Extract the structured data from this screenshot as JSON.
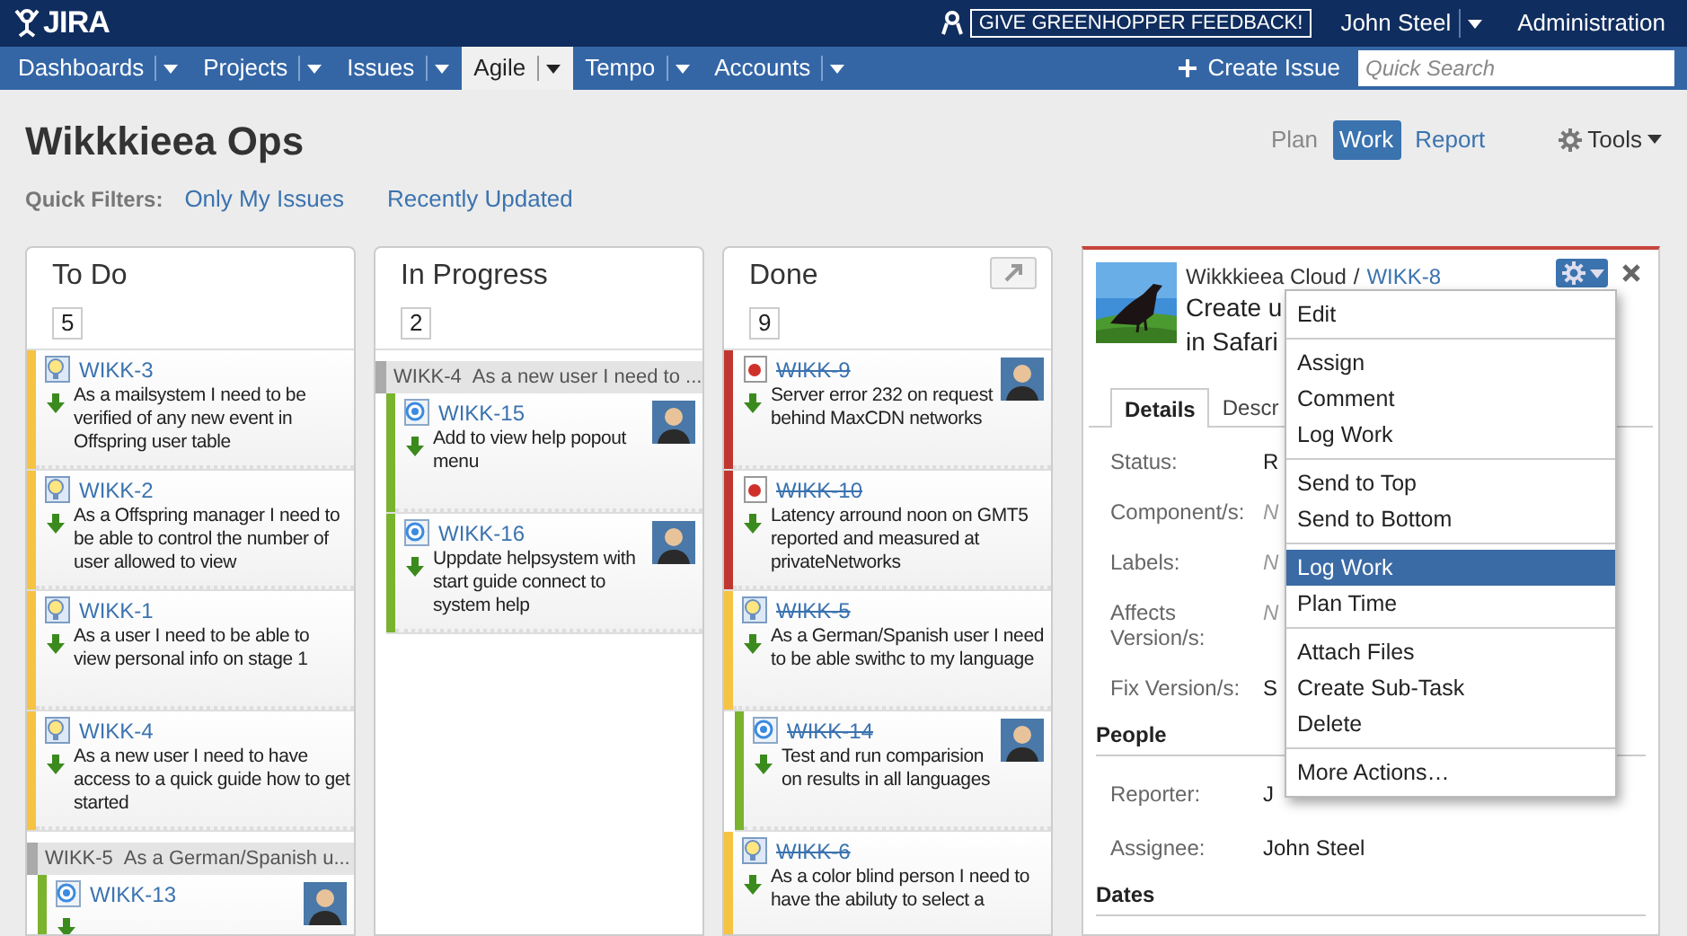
{
  "header": {
    "logo": "JIRA",
    "feedback": "GIVE GREENHOPPER FEEDBACK!",
    "user": "John Steel",
    "admin": "Administration"
  },
  "nav": {
    "items": [
      {
        "label": "Dashboards",
        "selected": false
      },
      {
        "label": "Projects",
        "selected": false
      },
      {
        "label": "Issues",
        "selected": false
      },
      {
        "label": "Agile",
        "selected": true
      },
      {
        "label": "Tempo",
        "selected": false
      },
      {
        "label": "Accounts",
        "selected": false
      }
    ],
    "create": "Create Issue",
    "search": {
      "placeholder": "Quick Search"
    }
  },
  "board": {
    "title": "Wikkkieea Ops",
    "quick_filters_label": "Quick Filters:",
    "quick_filters": [
      "Only My Issues",
      "Recently Updated"
    ],
    "modes": [
      {
        "label": "Plan",
        "selected": false
      },
      {
        "label": "Work",
        "selected": true
      },
      {
        "label": "Report",
        "selected": false
      }
    ],
    "tools": "Tools"
  },
  "columns": [
    {
      "name": "To Do",
      "count": "5",
      "expand_button": false,
      "items": [
        {
          "kind": "story",
          "key": "WIKK-3",
          "done": false,
          "avatar": false,
          "in_swimlane": false,
          "summary": "As a mailsystem I need to be verified of any new event in Offspring user table"
        },
        {
          "kind": "story",
          "key": "WIKK-2",
          "done": false,
          "avatar": false,
          "in_swimlane": false,
          "summary": "As a Offspring manager I need to be able to control the number of user allowed to view"
        },
        {
          "kind": "story",
          "key": "WIKK-1",
          "done": false,
          "avatar": false,
          "in_swimlane": false,
          "summary": "As a user I need to be able to view personal info on stage 1"
        },
        {
          "kind": "story",
          "key": "WIKK-4",
          "done": false,
          "avatar": false,
          "in_swimlane": false,
          "summary": "As a new user I need to have access to a quick guide how to get started"
        },
        {
          "kind": "swimlane",
          "key": "WIKK-5",
          "summary": "As a German/Spanish u..."
        },
        {
          "kind": "task",
          "key": "WIKK-13",
          "done": false,
          "avatar": true,
          "in_swimlane": true
        }
      ]
    },
    {
      "name": "In Progress",
      "count": "2",
      "expand_button": false,
      "items": [
        {
          "kind": "swimlane",
          "key": "WIKK-4",
          "summary": "As a new user I need to ..."
        },
        {
          "kind": "task",
          "key": "WIKK-15",
          "done": false,
          "avatar": true,
          "in_swimlane": true,
          "summary": "Add to view help popout menu"
        },
        {
          "kind": "task",
          "key": "WIKK-16",
          "done": false,
          "avatar": true,
          "in_swimlane": true,
          "summary": "Uppdate helpsystem with start guide connect to system help"
        }
      ]
    },
    {
      "name": "Done",
      "count": "9",
      "expand_button": true,
      "items": [
        {
          "kind": "bug",
          "key": "WIKK-9",
          "done": true,
          "avatar": true,
          "in_swimlane": false,
          "summary": "Server error 232 on request behind MaxCDN networks"
        },
        {
          "kind": "bug",
          "key": "WIKK-10",
          "done": true,
          "avatar": false,
          "in_swimlane": false,
          "summary": "Latency arround noon on GMT5 reported and measured at privateNetworks"
        },
        {
          "kind": "story",
          "key": "WIKK-5",
          "done": true,
          "avatar": false,
          "in_swimlane": false,
          "summary": "As a German/Spanish user I need to be able swithc to my language"
        },
        {
          "kind": "task",
          "key": "WIKK-14",
          "done": true,
          "avatar": true,
          "in_swimlane": true,
          "summary": "Test and run comparision on results in all languages"
        },
        {
          "kind": "story",
          "key": "WIKK-6",
          "done": true,
          "avatar": false,
          "in_swimlane": false,
          "summary": "As a color blind person I need to have the abiluty to select a"
        }
      ]
    }
  ],
  "detail": {
    "project": "Wikkkieea Cloud",
    "crumb_separator": "/",
    "key": "WIKK-8",
    "title_lines": [
      "Create u",
      "in Safari"
    ],
    "tabs": [
      {
        "label": "Details",
        "selected": true
      },
      {
        "label": "Descr",
        "selected": false
      }
    ],
    "fields": [
      {
        "label": "Status:",
        "value": "R",
        "empty": false
      },
      {
        "label": "Component/s:",
        "value": "N",
        "empty": true
      },
      {
        "label": "Labels:",
        "value": "N",
        "empty": true
      },
      {
        "label": "Affects Version/s:",
        "value": "N",
        "empty": true
      },
      {
        "label": "Fix Version/s:",
        "value": "S",
        "empty": false
      }
    ],
    "sections": [
      {
        "heading": "People",
        "fields": [
          {
            "label": "Reporter:",
            "value": "J",
            "empty": false
          },
          {
            "label": "Assignee:",
            "value": "John Steel",
            "empty": false
          }
        ]
      },
      {
        "heading": "Dates"
      }
    ],
    "menu": [
      [
        {
          "label": "Edit",
          "selected": false
        }
      ],
      [
        {
          "label": "Assign",
          "selected": false
        },
        {
          "label": "Comment",
          "selected": false
        },
        {
          "label": "Log Work",
          "selected": false
        }
      ],
      [
        {
          "label": "Send to Top",
          "selected": false
        },
        {
          "label": "Send to Bottom",
          "selected": false
        }
      ],
      [
        {
          "label": "Log Work",
          "selected": true
        },
        {
          "label": "Plan Time",
          "selected": false
        }
      ],
      [
        {
          "label": "Attach Files",
          "selected": false
        },
        {
          "label": "Create Sub-Task",
          "selected": false
        },
        {
          "label": "Delete",
          "selected": false
        }
      ],
      [
        {
          "label": "More Actions…",
          "selected": false
        }
      ]
    ]
  }
}
